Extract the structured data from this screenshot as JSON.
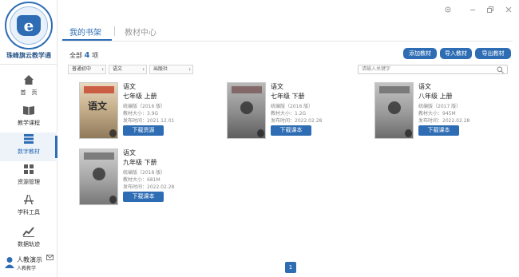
{
  "app": {
    "brand": "珠峰旗云教学通"
  },
  "sidebar": {
    "items": [
      {
        "label": "首　页",
        "icon": "home-icon"
      },
      {
        "label": "教学课程",
        "icon": "book-open-icon"
      },
      {
        "label": "数字教材",
        "icon": "books-stack-icon",
        "active": true
      },
      {
        "label": "资源管理",
        "icon": "grid-icon"
      },
      {
        "label": "学科工具",
        "icon": "compass-ruler-icon"
      },
      {
        "label": "数据轨迹",
        "icon": "chart-line-icon"
      }
    ],
    "user": {
      "name": "人教演示",
      "role": "人教教学"
    }
  },
  "tabs": [
    {
      "label": "我的书架",
      "active": true
    },
    {
      "label": "教材中心",
      "active": false
    }
  ],
  "summary": {
    "prefix": "全部",
    "count": "4",
    "suffix": "项"
  },
  "actions": {
    "add": "添加教材",
    "import": "导入教材",
    "export": "导出教材"
  },
  "filters": {
    "stage": "普通初中",
    "subject": "语文",
    "publisher": "出版社"
  },
  "search": {
    "placeholder": "请输入关键字"
  },
  "books": [
    {
      "name": "语文",
      "grade": "七年级 上册",
      "edition": "统编版（2016 版）",
      "size": "教材大小：3.9G",
      "date": "发布时间：2021.12.01",
      "button": "下载资源",
      "downloaded": true
    },
    {
      "name": "语文",
      "grade": "七年级 下册",
      "edition": "统编版（2016 版）",
      "size": "教材大小：1.2G",
      "date": "发布时间：2022.02.28",
      "button": "下载课本",
      "downloaded": false
    },
    {
      "name": "语文",
      "grade": "八年级 上册",
      "edition": "统编版（2017 版）",
      "size": "教材大小：945M",
      "date": "发布时间：2022.02.28",
      "button": "下载课本",
      "downloaded": false
    },
    {
      "name": "语文",
      "grade": "九年级 下册",
      "edition": "统编版（2018 版）",
      "size": "教材大小：681M",
      "date": "发布时间：2022.02.28",
      "button": "下载课本",
      "downloaded": false
    }
  ],
  "pager": {
    "current": "1"
  },
  "colors": {
    "accent": "#2e6db4"
  }
}
